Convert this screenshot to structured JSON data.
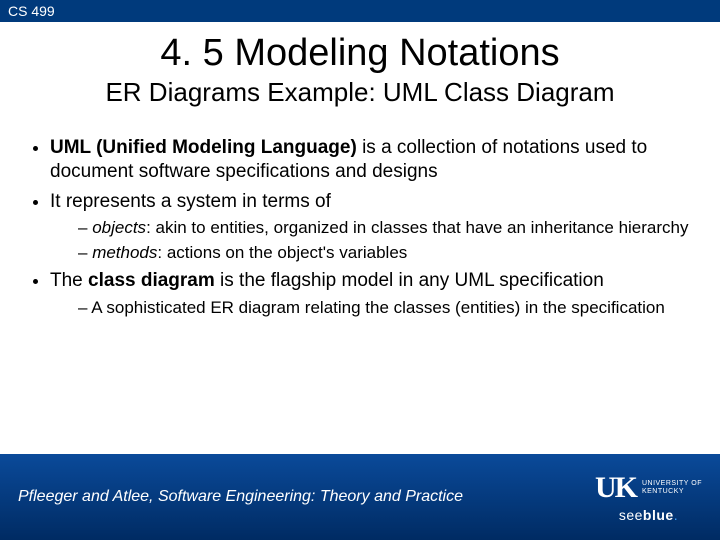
{
  "header": {
    "course": "CS 499"
  },
  "title": "4. 5 Modeling Notations",
  "subtitle": "ER Diagrams Example: UML Class Diagram",
  "bullets": {
    "b1_pre": "UML (Unified Modeling Language)",
    "b1_post": " is a collection of notations used to document software specifications and designs",
    "b2": "It represents a system in terms of",
    "b2_s1_em": "objects",
    "b2_s1_rest": ": akin to entities, organized in classes that have an inheritance hierarchy",
    "b2_s2_em": "methods",
    "b2_s2_rest": ": actions on the object's variables",
    "b3_pre": "The ",
    "b3_bold": "class diagram",
    "b3_post": " is the flagship model in any UML specification",
    "b3_s1": "A sophisticated ER diagram relating the classes (entities) in the specification"
  },
  "footer": {
    "credit": "Pfleeger and Atlee, Software Engineering: Theory and Practice",
    "logo_mark": "UK",
    "logo_line1": "UNIVERSITY OF",
    "logo_line2": "KENTUCKY",
    "tagline_a": "see",
    "tagline_b": "blue",
    "tagline_dot": "."
  }
}
